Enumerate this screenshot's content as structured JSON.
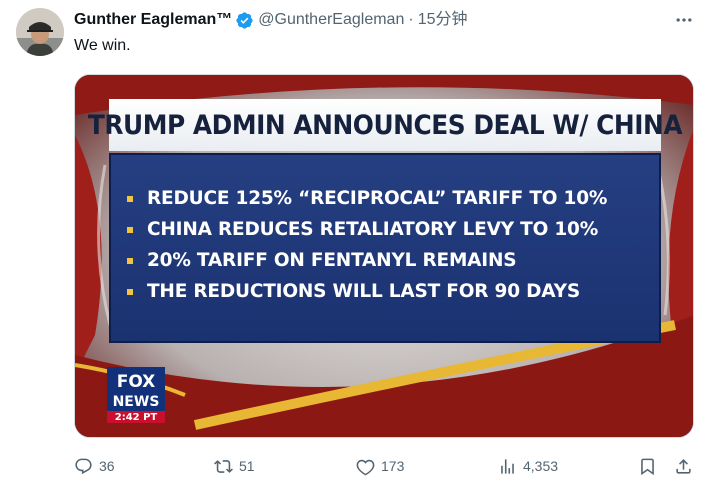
{
  "tweet": {
    "author": {
      "name": "Gunther Eagleman™",
      "handle": "@GuntherEagleman",
      "verified": true
    },
    "timestamp": "15分钟",
    "separator": "·",
    "text": "We win."
  },
  "media": {
    "headline": "TRUMP ADMIN ANNOUNCES DEAL W/ CHINA",
    "bullets": [
      "REDUCE 125% “RECIPROCAL” TARIFF TO 10%",
      "CHINA REDUCES RETALIATORY LEVY TO 10%",
      "20% TARIFF ON FENTANYL REMAINS",
      "THE REDUCTIONS WILL LAST FOR 90 DAYS"
    ],
    "network_logo": {
      "line1": "FOX",
      "line2": "NEWS"
    },
    "broadcast_time": "2:42 PT"
  },
  "actions": {
    "replies": "36",
    "retweets": "51",
    "likes": "173",
    "views": "4,353"
  },
  "colors": {
    "verified_badge": "#1d9bf0",
    "secondary_text": "#536471",
    "banner_blue": "#253f82"
  },
  "icons": [
    "verified-icon",
    "more-icon",
    "reply-icon",
    "retweet-icon",
    "like-icon",
    "views-icon",
    "bookmark-icon",
    "share-icon"
  ]
}
